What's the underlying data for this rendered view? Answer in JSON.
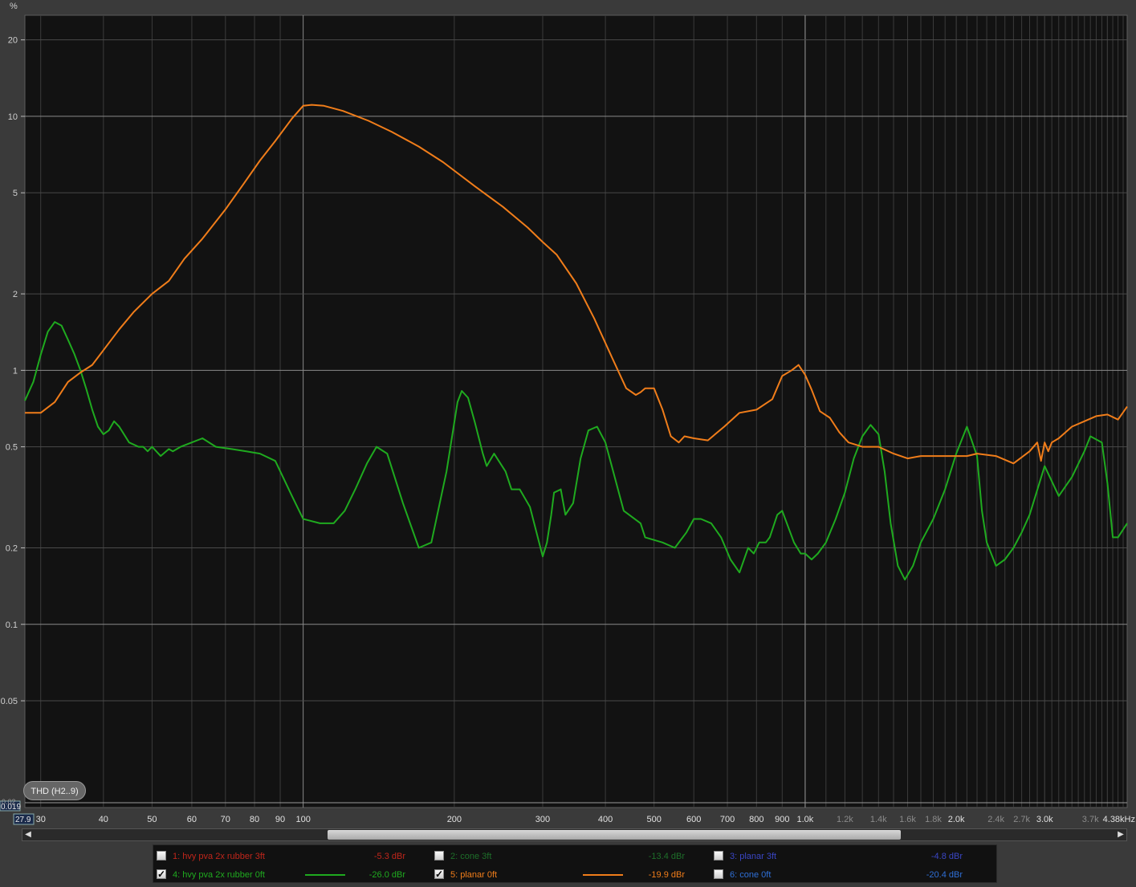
{
  "chart_data": {
    "type": "line",
    "ylabel": "%",
    "xunit": "kHz",
    "xscale": "log",
    "yscale": "log",
    "xlim": [
      27.9,
      4380
    ],
    "ylim": [
      0.019,
      25
    ],
    "ymin_readout": "0.019",
    "ycut_label": "0.02",
    "xmin_readout": "27.9",
    "yticks": [
      {
        "v": 20,
        "label": "20"
      },
      {
        "v": 10,
        "label": "10"
      },
      {
        "v": 5,
        "label": "5"
      },
      {
        "v": 2,
        "label": "2"
      },
      {
        "v": 1,
        "label": "1"
      },
      {
        "v": 0.5,
        "label": "0.5"
      },
      {
        "v": 0.2,
        "label": "0.2"
      },
      {
        "v": 0.1,
        "label": "0.1"
      },
      {
        "v": 0.05,
        "label": "0.05"
      }
    ],
    "xticks": [
      {
        "v": 30,
        "label": "30"
      },
      {
        "v": 40,
        "label": "40"
      },
      {
        "v": 50,
        "label": "50"
      },
      {
        "v": 60,
        "label": "60"
      },
      {
        "v": 70,
        "label": "70"
      },
      {
        "v": 80,
        "label": "80"
      },
      {
        "v": 90,
        "label": "90"
      },
      {
        "v": 100,
        "label": "100"
      },
      {
        "v": 200,
        "label": "200"
      },
      {
        "v": 300,
        "label": "300"
      },
      {
        "v": 400,
        "label": "400"
      },
      {
        "v": 500,
        "label": "500"
      },
      {
        "v": 600,
        "label": "600"
      },
      {
        "v": 700,
        "label": "700"
      },
      {
        "v": 800,
        "label": "800"
      },
      {
        "v": 900,
        "label": "900"
      },
      {
        "v": 1000,
        "label": "1.0k"
      },
      {
        "v": 1200,
        "label": "1.2k",
        "dim": true
      },
      {
        "v": 1400,
        "label": "1.4k",
        "dim": true
      },
      {
        "v": 1600,
        "label": "1.6k",
        "dim": true
      },
      {
        "v": 1800,
        "label": "1.8k",
        "dim": true
      },
      {
        "v": 2000,
        "label": "2.0k"
      },
      {
        "v": 2400,
        "label": "2.4k",
        "dim": true
      },
      {
        "v": 2700,
        "label": "2.7k",
        "dim": true
      },
      {
        "v": 3000,
        "label": "3.0k"
      },
      {
        "v": 3700,
        "label": "3.7k",
        "dim": true
      },
      {
        "v": 4380,
        "label": "4.38kHz"
      }
    ],
    "series": [
      {
        "name": "4: hvy pva 2x rubber 0ft",
        "color": "#1faa1f",
        "x": [
          27.9,
          29,
          30,
          31,
          32,
          33,
          34,
          35,
          36,
          37,
          38,
          39,
          40,
          41,
          42,
          43,
          45,
          47,
          48,
          49,
          50,
          52,
          54,
          55,
          57,
          60,
          63,
          67,
          72,
          77,
          82,
          88,
          95,
          100,
          108,
          115,
          121,
          127,
          134,
          140,
          147,
          158,
          170,
          180,
          193,
          203,
          207,
          213,
          220,
          228,
          232,
          240,
          253,
          260,
          270,
          283,
          300,
          306,
          312,
          316,
          326,
          333,
          345,
          357,
          370,
          385,
          400,
          416,
          435,
          470,
          480,
          520,
          550,
          580,
          600,
          620,
          650,
          680,
          710,
          740,
          770,
          790,
          810,
          835,
          850,
          880,
          900,
          950,
          980,
          1000,
          1030,
          1060,
          1100,
          1150,
          1200,
          1250,
          1300,
          1350,
          1400,
          1440,
          1480,
          1530,
          1580,
          1640,
          1700,
          1800,
          1900,
          2000,
          2100,
          2200,
          2250,
          2300,
          2400,
          2500,
          2600,
          2700,
          2800,
          3000,
          3200,
          3400,
          3600,
          3700,
          3900,
          4000,
          4100,
          4200,
          4380
        ],
        "y": [
          0.76,
          0.9,
          1.15,
          1.42,
          1.55,
          1.5,
          1.32,
          1.16,
          1.0,
          0.84,
          0.7,
          0.6,
          0.56,
          0.58,
          0.63,
          0.6,
          0.52,
          0.5,
          0.5,
          0.48,
          0.5,
          0.46,
          0.49,
          0.48,
          0.5,
          0.52,
          0.54,
          0.5,
          0.49,
          0.48,
          0.47,
          0.44,
          0.32,
          0.26,
          0.25,
          0.25,
          0.28,
          0.34,
          0.43,
          0.5,
          0.47,
          0.3,
          0.2,
          0.21,
          0.4,
          0.75,
          0.83,
          0.78,
          0.62,
          0.47,
          0.42,
          0.47,
          0.4,
          0.34,
          0.34,
          0.29,
          0.185,
          0.21,
          0.27,
          0.33,
          0.34,
          0.27,
          0.3,
          0.45,
          0.58,
          0.6,
          0.52,
          0.39,
          0.28,
          0.25,
          0.22,
          0.21,
          0.2,
          0.23,
          0.26,
          0.26,
          0.25,
          0.22,
          0.18,
          0.16,
          0.2,
          0.19,
          0.21,
          0.21,
          0.22,
          0.27,
          0.28,
          0.21,
          0.19,
          0.19,
          0.18,
          0.19,
          0.21,
          0.26,
          0.33,
          0.45,
          0.55,
          0.61,
          0.56,
          0.4,
          0.25,
          0.17,
          0.15,
          0.17,
          0.21,
          0.26,
          0.34,
          0.47,
          0.6,
          0.46,
          0.28,
          0.21,
          0.17,
          0.18,
          0.2,
          0.23,
          0.27,
          0.42,
          0.32,
          0.38,
          0.48,
          0.55,
          0.52,
          0.36,
          0.22,
          0.22,
          0.25
        ]
      },
      {
        "name": "5: planar 0ft",
        "color": "#f07d1a",
        "x": [
          27.9,
          30,
          32,
          34,
          36,
          38,
          40,
          43,
          46,
          50,
          54,
          58,
          63,
          70,
          76,
          82,
          88,
          95,
          100,
          104,
          110,
          120,
          135,
          150,
          170,
          190,
          220,
          250,
          280,
          300,
          320,
          350,
          380,
          410,
          440,
          460,
          470,
          480,
          500,
          520,
          540,
          560,
          575,
          600,
          640,
          690,
          740,
          800,
          860,
          900,
          940,
          970,
          1000,
          1030,
          1070,
          1120,
          1170,
          1220,
          1300,
          1400,
          1500,
          1600,
          1700,
          1800,
          1900,
          2000,
          2100,
          2200,
          2400,
          2600,
          2800,
          2900,
          2950,
          3000,
          3050,
          3100,
          3200,
          3400,
          3600,
          3800,
          4000,
          4200,
          4380
        ],
        "y": [
          0.68,
          0.68,
          0.75,
          0.9,
          0.98,
          1.05,
          1.2,
          1.45,
          1.7,
          2.0,
          2.25,
          2.75,
          3.3,
          4.3,
          5.4,
          6.7,
          8.0,
          9.8,
          11.0,
          11.1,
          11.0,
          10.5,
          9.6,
          8.7,
          7.6,
          6.6,
          5.3,
          4.4,
          3.65,
          3.2,
          2.85,
          2.2,
          1.6,
          1.15,
          0.85,
          0.8,
          0.82,
          0.85,
          0.85,
          0.7,
          0.55,
          0.52,
          0.55,
          0.54,
          0.53,
          0.6,
          0.68,
          0.7,
          0.77,
          0.95,
          1.0,
          1.05,
          0.96,
          0.84,
          0.69,
          0.65,
          0.57,
          0.52,
          0.5,
          0.5,
          0.47,
          0.45,
          0.46,
          0.46,
          0.46,
          0.46,
          0.46,
          0.47,
          0.46,
          0.43,
          0.48,
          0.52,
          0.44,
          0.52,
          0.48,
          0.52,
          0.54,
          0.6,
          0.63,
          0.66,
          0.67,
          0.64,
          0.72
        ]
      }
    ]
  },
  "thd_tag": "THD (H2..9)",
  "legend": {
    "items": [
      {
        "label": "1: hvy pva 2x rubber 3ft",
        "value": "-5.3 dBr",
        "color": "#c0261b",
        "checked": false
      },
      {
        "label": "2: cone 3ft",
        "value": "-13.4 dBr",
        "color": "#1e6f2a",
        "checked": false
      },
      {
        "label": "3: planar 3ft",
        "value": "-4.8 dBr",
        "color": "#3a46c4",
        "checked": false
      },
      {
        "label": "4: hvy pva 2x rubber 0ft",
        "value": "-26.0 dBr",
        "color": "#1faa1f",
        "checked": true
      },
      {
        "label": "5: planar 0ft",
        "value": "-19.9 dBr",
        "color": "#f07d1a",
        "checked": true
      },
      {
        "label": "6: cone 0ft",
        "value": "-20.4 dBr",
        "color": "#2f6fd6",
        "checked": false
      }
    ],
    "check_mark": "✓"
  },
  "scroll": {
    "left_arrow": "◀",
    "right_arrow": "▶"
  }
}
